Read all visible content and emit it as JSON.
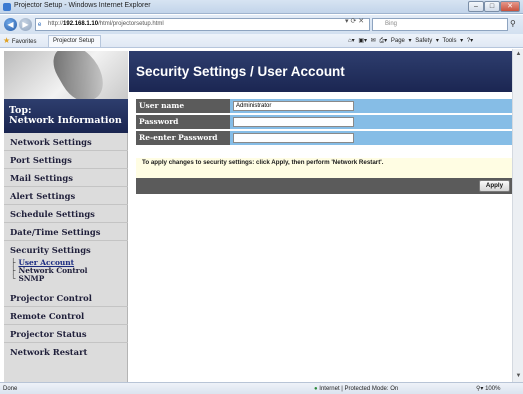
{
  "window": {
    "title": "Projector Setup - Windows Internet Explorer"
  },
  "address": {
    "url_prefix": "http://",
    "url_host": "192.168.1.10",
    "url_path": "/html/projectorsetup.html",
    "search_placeholder": "Bing"
  },
  "favorites": {
    "favorites_label": "Favorites",
    "tab_label": "Projector Setup",
    "commands": "Page ▾  Safety ▾  Tools ▾"
  },
  "sidebar": {
    "top_line1": "Top:",
    "top_line2": "Network Information",
    "items": [
      {
        "label": "Network Settings"
      },
      {
        "label": "Port Settings"
      },
      {
        "label": "Mail Settings"
      },
      {
        "label": "Alert Settings"
      },
      {
        "label": "Schedule Settings"
      },
      {
        "label": "Date/Time Settings"
      },
      {
        "label": "Security Settings"
      }
    ],
    "subitems": [
      {
        "label": "User Account"
      },
      {
        "label": "Network Control"
      },
      {
        "label": "SNMP"
      }
    ],
    "bottom_items": [
      {
        "label": "Projector Control"
      },
      {
        "label": "Remote Control"
      },
      {
        "label": "Projector Status"
      },
      {
        "label": "Network Restart"
      }
    ]
  },
  "main": {
    "title": "Security Settings / User Account",
    "fields": [
      {
        "label": "User name",
        "value": "Administrator"
      },
      {
        "label": "Password",
        "value": ""
      },
      {
        "label": "Re-enter Password",
        "value": ""
      }
    ],
    "notice": "To apply changes to security settings: click Apply, then perform 'Network Restart'.",
    "apply_label": "Apply"
  },
  "status": {
    "left": "Done",
    "zone": "Internet | Protected Mode: On",
    "zoom": "100%"
  },
  "colors": {
    "nav_dark": "#1b2652",
    "form_row": "#86bde6",
    "label_bg": "#5b5b5b"
  }
}
